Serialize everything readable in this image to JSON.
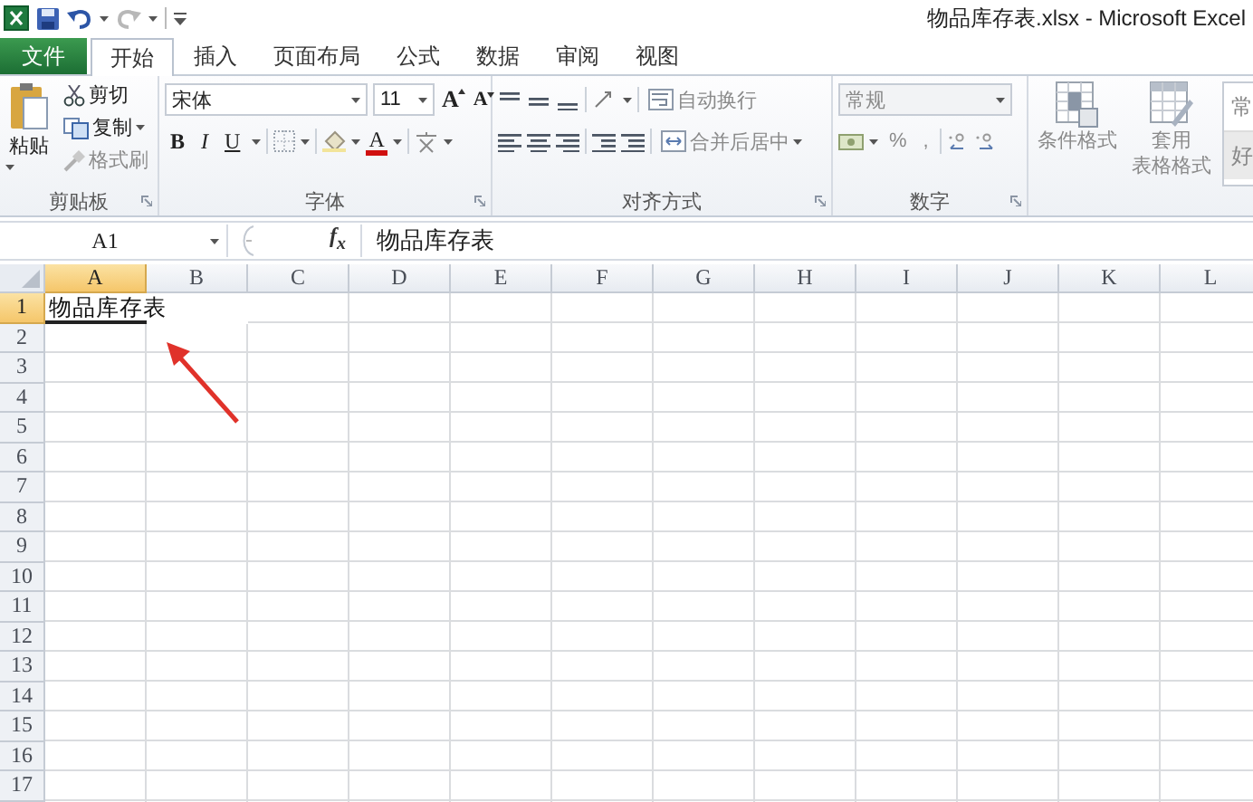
{
  "window": {
    "title": "物品库存表.xlsx - Microsoft Excel"
  },
  "tabs": [
    {
      "label": "文件",
      "kind": "file",
      "selected": false
    },
    {
      "label": "开始",
      "kind": "tab",
      "selected": true
    },
    {
      "label": "插入",
      "kind": "tab",
      "selected": false
    },
    {
      "label": "页面布局",
      "kind": "tab",
      "selected": false
    },
    {
      "label": "公式",
      "kind": "tab",
      "selected": false
    },
    {
      "label": "数据",
      "kind": "tab",
      "selected": false
    },
    {
      "label": "审阅",
      "kind": "tab",
      "selected": false
    },
    {
      "label": "视图",
      "kind": "tab",
      "selected": false
    }
  ],
  "ribbon": {
    "clipboard": {
      "label": "剪贴板",
      "paste": {
        "label": "粘贴",
        "disabled": false
      },
      "cut": {
        "label": "剪切",
        "disabled": false
      },
      "copy": {
        "label": "复制",
        "disabled": false
      },
      "format_painter": {
        "label": "格式刷",
        "disabled": true
      }
    },
    "font": {
      "label": "字体",
      "font_name": "宋体",
      "font_size": "11",
      "grow": "A",
      "shrink": "A",
      "bold": "B",
      "italic": "I",
      "underline": "U",
      "font_color": "A"
    },
    "alignment": {
      "label": "对齐方式",
      "wrap_text": {
        "label": "自动换行",
        "disabled": true
      },
      "merge_center": {
        "label": "合并后居中",
        "disabled": true
      }
    },
    "number": {
      "label": "数字",
      "format": {
        "value": "常规",
        "disabled": true
      },
      "percent": "%",
      "comma": ","
    },
    "styles": {
      "conditional_formatting": {
        "label": "条件格式",
        "disabled": true
      },
      "format_as_table": {
        "lines": [
          "套用",
          "表格格式"
        ],
        "disabled": true
      },
      "cell_styles": [
        "常",
        "好"
      ]
    }
  },
  "formula_bar": {
    "name_box": "A1",
    "function_label": "f$_{x}$",
    "content": "物品库存表"
  },
  "sheet": {
    "columns": [
      {
        "label": "A",
        "selected": true
      },
      {
        "label": "B",
        "selected": false
      },
      {
        "label": "C",
        "selected": false
      },
      {
        "label": "D",
        "selected": false
      },
      {
        "label": "E",
        "selected": false
      },
      {
        "label": "F",
        "selected": false
      },
      {
        "label": "G",
        "selected": false
      },
      {
        "label": "H",
        "selected": false
      },
      {
        "label": "I",
        "selected": false
      },
      {
        "label": "J",
        "selected": false
      },
      {
        "label": "K",
        "selected": false
      },
      {
        "label": "L",
        "selected": false
      }
    ],
    "rows": [
      {
        "label": "1",
        "selected": true,
        "cells": [
          "物品库存表"
        ]
      },
      {
        "label": "2",
        "selected": false
      },
      {
        "label": "3",
        "selected": false
      },
      {
        "label": "4",
        "selected": false
      },
      {
        "label": "5",
        "selected": false
      },
      {
        "label": "6",
        "selected": false
      },
      {
        "label": "7",
        "selected": false
      },
      {
        "label": "8",
        "selected": false
      },
      {
        "label": "9",
        "selected": false
      },
      {
        "label": "10",
        "selected": false
      },
      {
        "label": "11",
        "selected": false
      },
      {
        "label": "12",
        "selected": false
      },
      {
        "label": "13",
        "selected": false
      },
      {
        "label": "14",
        "selected": false
      },
      {
        "label": "15",
        "selected": false
      },
      {
        "label": "16",
        "selected": false
      },
      {
        "label": "17",
        "selected": false
      }
    ]
  }
}
